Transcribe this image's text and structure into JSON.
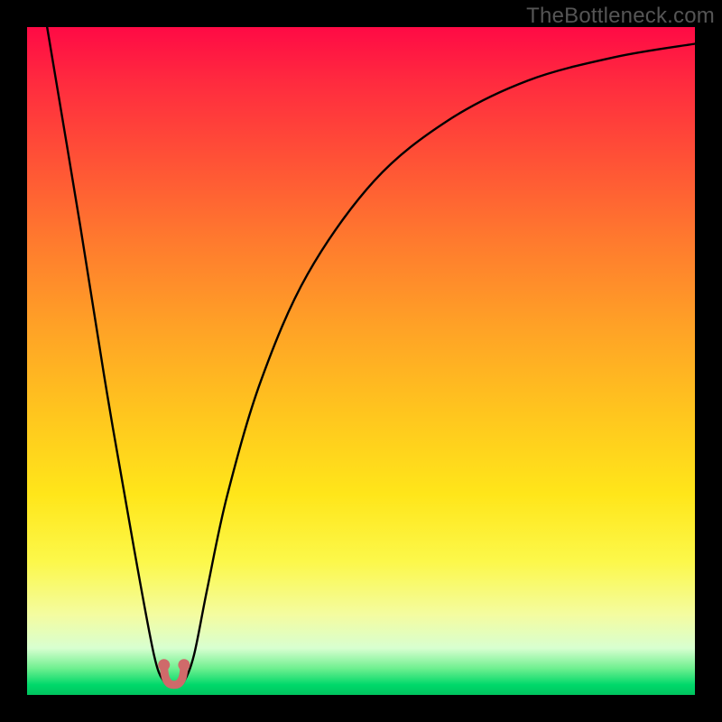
{
  "watermark": "TheBottleneck.com",
  "chart_data": {
    "type": "line",
    "title": "",
    "xlabel": "",
    "ylabel": "",
    "xlim": [
      0,
      1
    ],
    "ylim": [
      0,
      1
    ],
    "series": [
      {
        "name": "bottleneck-curve",
        "x": [
          0.03,
          0.08,
          0.12,
          0.16,
          0.19,
          0.205,
          0.215,
          0.225,
          0.235,
          0.25,
          0.27,
          0.3,
          0.35,
          0.42,
          0.52,
          0.63,
          0.75,
          0.88,
          1.0
        ],
        "y": [
          1.0,
          0.7,
          0.45,
          0.22,
          0.06,
          0.02,
          0.015,
          0.015,
          0.02,
          0.06,
          0.16,
          0.3,
          0.47,
          0.63,
          0.77,
          0.86,
          0.92,
          0.955,
          0.975
        ]
      }
    ],
    "min_marker": {
      "x_range": [
        0.205,
        0.235
      ],
      "y": 0.015
    },
    "background": "heatmap-gradient-red-to-green-vertical"
  },
  "colors": {
    "frame": "#000000",
    "curve": "#000000",
    "marker": "#cf6a6a",
    "watermark": "#555555"
  }
}
